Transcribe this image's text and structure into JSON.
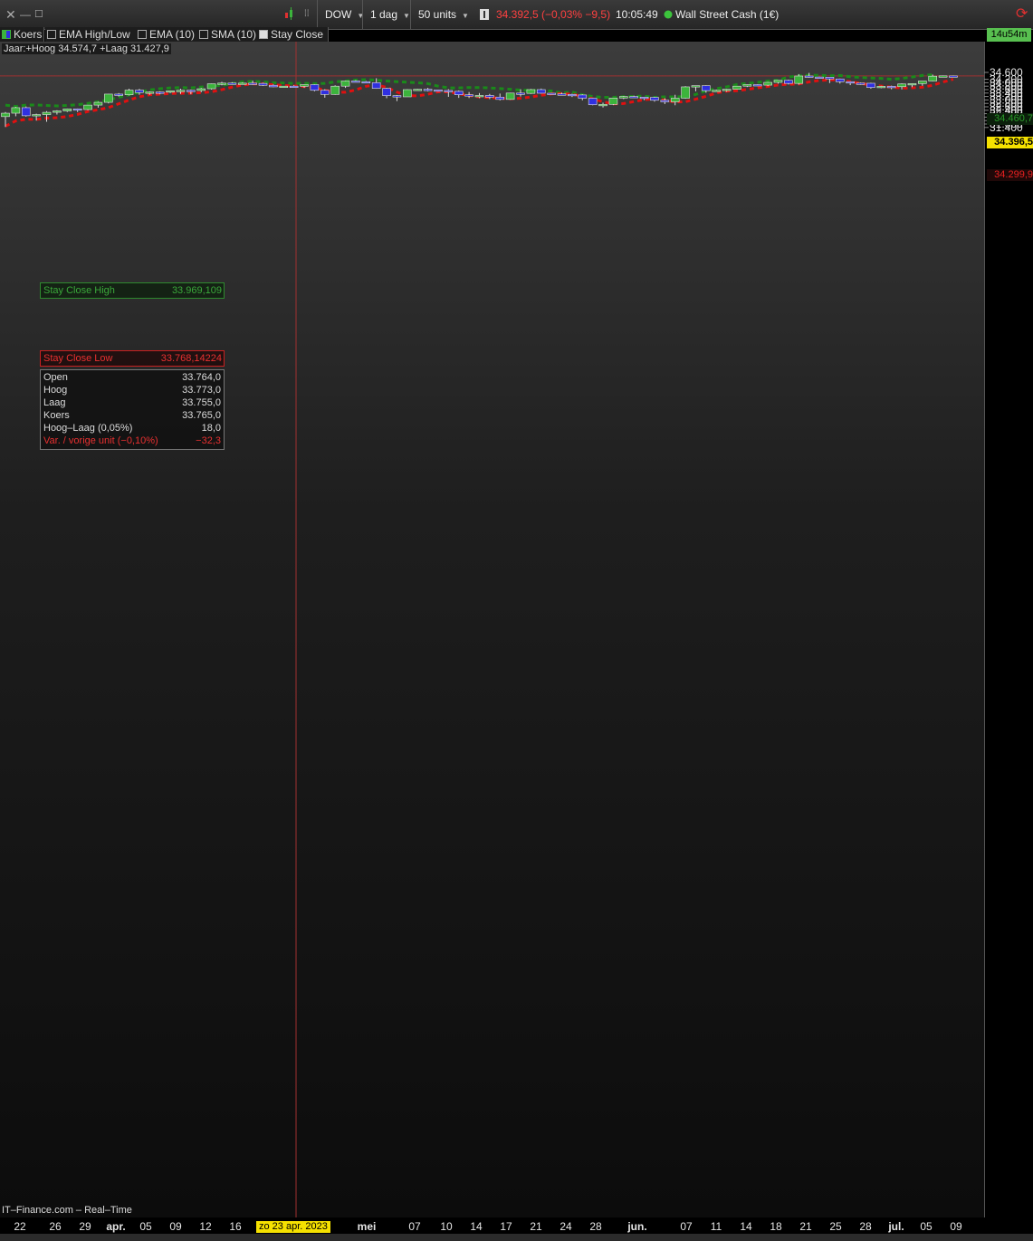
{
  "toolbar": {
    "symbol": "DOW",
    "period": "1 dag",
    "units": "50 units",
    "price_line": "34.392,5 (−0,03% −9,5)",
    "time": "10:05:49",
    "instrument": "Wall Street Cash (1€)"
  },
  "legend": {
    "items": [
      "Koers",
      "EMA High/Low",
      "EMA (10)",
      "SMA (10)",
      "Stay Close"
    ],
    "year_info": "Jaar:+Hoog 34.574,7 +Laag 31.427,9"
  },
  "timer": "14u54m",
  "footer": "IT–Finance.com – Real–Time",
  "crosshair": {
    "date_label": "zo 23 apr. 2023"
  },
  "price_boxes": {
    "last": "34.396,5",
    "stay_high": "34.460,7",
    "stay_low": "34.299,9"
  },
  "stay_close_high": {
    "label": "Stay Close High",
    "value": "33.969,109"
  },
  "stay_close_low": {
    "label": "Stay Close Low",
    "value": "33.768,14224"
  },
  "infobox": {
    "rows": [
      {
        "label": "Open",
        "value": "33.764,0"
      },
      {
        "label": "Hoog",
        "value": "33.773,0"
      },
      {
        "label": "Laag",
        "value": "33.755,0"
      },
      {
        "label": "Koers",
        "value": "33.765,0"
      },
      {
        "label": "Hoog–Laag (0,05%)",
        "value": "18,0"
      },
      {
        "label": "Var. / vorige unit (−0,10%)",
        "value": "−32,3"
      }
    ]
  },
  "colors": {
    "up_candle": "#3cb43c",
    "down_candle": "#3030e0",
    "stay_high_line": "#1a8a1a",
    "stay_low_line": "#e01010",
    "crosshair": "#a03030"
  },
  "chart_data": {
    "type": "candlestick",
    "y_axis": {
      "ticks": [
        34600,
        34200,
        34000,
        33800,
        33600,
        33400,
        33200,
        33000,
        32800,
        32600,
        32400,
        32200,
        32000,
        31800,
        31600,
        31400
      ],
      "tick_labels": [
        "34.600",
        "34.200",
        "34.000",
        "33.800",
        "33.600",
        "33.400",
        "33.200",
        "33.000",
        "32.800",
        "32.600",
        "32.400",
        "32.200",
        "32.000",
        "31.800",
        "31.600",
        "31.400"
      ]
    },
    "x_axis": {
      "tick_labels": [
        "22",
        "26",
        "29",
        "apr.",
        "05",
        "09",
        "12",
        "16",
        "mei",
        "07",
        "10",
        "14",
        "17",
        "21",
        "24",
        "28",
        "jun.",
        "07",
        "11",
        "14",
        "18",
        "21",
        "25",
        "28",
        "jul.",
        "05",
        "09"
      ]
    },
    "candles": [
      {
        "o": 32030,
        "h": 32300,
        "l": 31430,
        "c": 32230
      },
      {
        "o": 32230,
        "h": 32600,
        "l": 32050,
        "c": 32550
      },
      {
        "o": 32550,
        "h": 32620,
        "l": 32030,
        "c": 32080
      },
      {
        "o": 32080,
        "h": 32200,
        "l": 31800,
        "c": 32150
      },
      {
        "o": 32150,
        "h": 32350,
        "l": 31730,
        "c": 32280
      },
      {
        "o": 32280,
        "h": 32400,
        "l": 32150,
        "c": 32360
      },
      {
        "o": 32360,
        "h": 32500,
        "l": 32300,
        "c": 32480
      },
      {
        "o": 32480,
        "h": 32500,
        "l": 32300,
        "c": 32440
      },
      {
        "o": 32440,
        "h": 32700,
        "l": 32400,
        "c": 32700
      },
      {
        "o": 32700,
        "h": 32900,
        "l": 32550,
        "c": 32860
      },
      {
        "o": 32860,
        "h": 33350,
        "l": 32800,
        "c": 33340
      },
      {
        "o": 33340,
        "h": 33400,
        "l": 33200,
        "c": 33300
      },
      {
        "o": 33300,
        "h": 33650,
        "l": 33260,
        "c": 33570
      },
      {
        "o": 33570,
        "h": 33640,
        "l": 33300,
        "c": 33430
      },
      {
        "o": 33430,
        "h": 33500,
        "l": 33300,
        "c": 33460
      },
      {
        "o": 33460,
        "h": 33500,
        "l": 33330,
        "c": 33450
      },
      {
        "o": 33450,
        "h": 33550,
        "l": 33400,
        "c": 33530
      },
      {
        "o": 33530,
        "h": 33650,
        "l": 33350,
        "c": 33560
      },
      {
        "o": 33560,
        "h": 33600,
        "l": 33330,
        "c": 33550
      },
      {
        "o": 33550,
        "h": 33700,
        "l": 33450,
        "c": 33650
      },
      {
        "o": 33650,
        "h": 33950,
        "l": 33600,
        "c": 33940
      },
      {
        "o": 33940,
        "h": 34050,
        "l": 33850,
        "c": 33980
      },
      {
        "o": 33980,
        "h": 34030,
        "l": 33920,
        "c": 33960
      },
      {
        "o": 33960,
        "h": 34020,
        "l": 33930,
        "c": 33975
      },
      {
        "o": 33975,
        "h": 34120,
        "l": 33880,
        "c": 33960
      },
      {
        "o": 33960,
        "h": 34000,
        "l": 33820,
        "c": 33850
      },
      {
        "o": 33850,
        "h": 33900,
        "l": 33740,
        "c": 33760
      },
      {
        "o": 33764,
        "h": 33773,
        "l": 33755,
        "c": 33800
      },
      {
        "o": 33800,
        "h": 33850,
        "l": 33760,
        "c": 33790
      },
      {
        "o": 33790,
        "h": 33900,
        "l": 33700,
        "c": 33890
      },
      {
        "o": 33890,
        "h": 33910,
        "l": 33500,
        "c": 33560
      },
      {
        "o": 33560,
        "h": 33620,
        "l": 33130,
        "c": 33320
      },
      {
        "o": 33320,
        "h": 33850,
        "l": 33300,
        "c": 33800
      },
      {
        "o": 33800,
        "h": 34120,
        "l": 33700,
        "c": 34100
      },
      {
        "o": 34100,
        "h": 34150,
        "l": 34040,
        "c": 34060
      },
      {
        "o": 34060,
        "h": 34100,
        "l": 33980,
        "c": 34000
      },
      {
        "o": 34000,
        "h": 34260,
        "l": 33650,
        "c": 33670
      },
      {
        "o": 33670,
        "h": 33700,
        "l": 33100,
        "c": 33250
      },
      {
        "o": 33250,
        "h": 33280,
        "l": 32930,
        "c": 33180
      },
      {
        "o": 33180,
        "h": 33620,
        "l": 33180,
        "c": 33600
      },
      {
        "o": 33600,
        "h": 33640,
        "l": 33560,
        "c": 33620
      },
      {
        "o": 33620,
        "h": 33700,
        "l": 33500,
        "c": 33580
      },
      {
        "o": 33580,
        "h": 33600,
        "l": 33480,
        "c": 33550
      },
      {
        "o": 33550,
        "h": 33620,
        "l": 33180,
        "c": 33500
      },
      {
        "o": 33500,
        "h": 33550,
        "l": 33120,
        "c": 33300
      },
      {
        "o": 33300,
        "h": 33460,
        "l": 33110,
        "c": 33230
      },
      {
        "o": 33230,
        "h": 33400,
        "l": 33110,
        "c": 33260
      },
      {
        "o": 33260,
        "h": 33350,
        "l": 33050,
        "c": 33160
      },
      {
        "o": 33160,
        "h": 33370,
        "l": 32970,
        "c": 33030
      },
      {
        "o": 33030,
        "h": 33420,
        "l": 33010,
        "c": 33400
      },
      {
        "o": 33400,
        "h": 33620,
        "l": 33200,
        "c": 33380
      },
      {
        "o": 33380,
        "h": 33640,
        "l": 33350,
        "c": 33600
      },
      {
        "o": 33600,
        "h": 33660,
        "l": 33370,
        "c": 33390
      },
      {
        "o": 33390,
        "h": 33400,
        "l": 33320,
        "c": 33350
      },
      {
        "o": 33350,
        "h": 33420,
        "l": 33280,
        "c": 33320
      },
      {
        "o": 33320,
        "h": 33360,
        "l": 33170,
        "c": 33290
      },
      {
        "o": 33290,
        "h": 33330,
        "l": 32980,
        "c": 33100
      },
      {
        "o": 33100,
        "h": 33110,
        "l": 32690,
        "c": 32720
      },
      {
        "o": 32720,
        "h": 32840,
        "l": 32560,
        "c": 32740
      },
      {
        "o": 32740,
        "h": 33100,
        "l": 32700,
        "c": 33110
      },
      {
        "o": 33110,
        "h": 33230,
        "l": 33050,
        "c": 33200
      },
      {
        "o": 33200,
        "h": 33250,
        "l": 33150,
        "c": 33160
      },
      {
        "o": 33160,
        "h": 33180,
        "l": 32990,
        "c": 33150
      },
      {
        "o": 33150,
        "h": 33180,
        "l": 32900,
        "c": 32980
      },
      {
        "o": 32980,
        "h": 33100,
        "l": 32760,
        "c": 32890
      },
      {
        "o": 32890,
        "h": 33300,
        "l": 32690,
        "c": 33100
      },
      {
        "o": 33100,
        "h": 33800,
        "l": 33070,
        "c": 33760
      },
      {
        "o": 33760,
        "h": 33800,
        "l": 33500,
        "c": 33830
      },
      {
        "o": 33830,
        "h": 33850,
        "l": 33420,
        "c": 33540
      },
      {
        "o": 33540,
        "h": 33600,
        "l": 33470,
        "c": 33560
      },
      {
        "o": 33560,
        "h": 33640,
        "l": 33480,
        "c": 33620
      },
      {
        "o": 33620,
        "h": 33810,
        "l": 33600,
        "c": 33800
      },
      {
        "o": 33800,
        "h": 33900,
        "l": 33750,
        "c": 33890
      },
      {
        "o": 33890,
        "h": 33910,
        "l": 33820,
        "c": 33860
      },
      {
        "o": 33860,
        "h": 34050,
        "l": 33800,
        "c": 34020
      },
      {
        "o": 34020,
        "h": 34150,
        "l": 33950,
        "c": 34140
      },
      {
        "o": 34140,
        "h": 34180,
        "l": 33900,
        "c": 33960
      },
      {
        "o": 33960,
        "h": 34500,
        "l": 33890,
        "c": 34390
      },
      {
        "o": 34390,
        "h": 34570,
        "l": 34290,
        "c": 34330
      },
      {
        "o": 34330,
        "h": 34350,
        "l": 34300,
        "c": 34320
      },
      {
        "o": 34320,
        "h": 34330,
        "l": 33980,
        "c": 34220
      },
      {
        "o": 34220,
        "h": 34240,
        "l": 33950,
        "c": 34060
      },
      {
        "o": 34060,
        "h": 34080,
        "l": 33860,
        "c": 33980
      },
      {
        "o": 33980,
        "h": 34010,
        "l": 33880,
        "c": 33970
      },
      {
        "o": 33970,
        "h": 34000,
        "l": 33650,
        "c": 33720
      },
      {
        "o": 33720,
        "h": 33820,
        "l": 33680,
        "c": 33790
      },
      {
        "o": 33790,
        "h": 33830,
        "l": 33620,
        "c": 33770
      },
      {
        "o": 33770,
        "h": 33960,
        "l": 33610,
        "c": 33930
      },
      {
        "o": 33930,
        "h": 33970,
        "l": 33740,
        "c": 33950
      },
      {
        "o": 33950,
        "h": 34100,
        "l": 33820,
        "c": 34100
      },
      {
        "o": 34100,
        "h": 34470,
        "l": 34080,
        "c": 34380
      },
      {
        "o": 34380,
        "h": 34420,
        "l": 34370,
        "c": 34400
      },
      {
        "o": 34396,
        "h": 34420,
        "l": 34380,
        "c": 34392
      }
    ],
    "stay_close_high": [
      32700,
      32620,
      32700,
      32710,
      32680,
      32650,
      32680,
      32720,
      32800,
      32900,
      33000,
      33150,
      33300,
      33450,
      33580,
      33650,
      33700,
      33720,
      33700,
      33750,
      33800,
      33850,
      33950,
      34050,
      34080,
      34050,
      34000,
      33980,
      33960,
      33970,
      33950,
      33960,
      34050,
      34100,
      34160,
      34180,
      34150,
      34100,
      34060,
      34030,
      34000,
      33950,
      33800,
      33700,
      33700,
      33720,
      33720,
      33700,
      33660,
      33620,
      33570,
      33560,
      33540,
      33520,
      33400,
      33460,
      33300,
      33200,
      33150,
      33150,
      33190,
      33210,
      33220,
      33150,
      33180,
      33180,
      33200,
      33320,
      33540,
      33650,
      33760,
      33900,
      33960,
      34020,
      34100,
      34150,
      34330,
      34400,
      34440,
      34430,
      34400,
      34420,
      34350,
      34300,
      34280,
      34250,
      34200,
      34250,
      34330,
      34420,
      34470
    ]
  }
}
